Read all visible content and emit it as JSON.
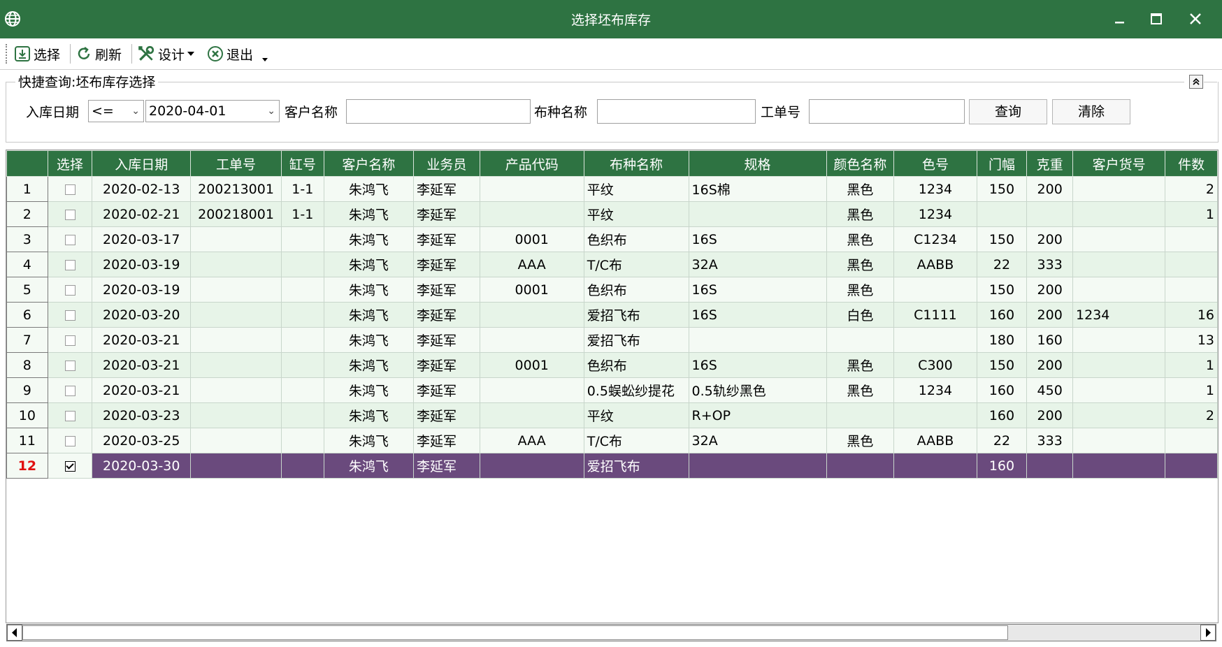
{
  "window": {
    "title": "选择坯布库存"
  },
  "toolbar": {
    "select": "选择",
    "refresh": "刷新",
    "design": "设计",
    "exit": "退出"
  },
  "query": {
    "legend": "快捷查询:坯布库存选择",
    "date_label": "入库日期",
    "operator": "<=",
    "date_value": "2020-04-01",
    "customer_label": "客户名称",
    "fabric_label": "布种名称",
    "order_label": "工单号",
    "search_btn": "查询",
    "clear_btn": "清除"
  },
  "table": {
    "columns": [
      "",
      "选择",
      "入库日期",
      "工单号",
      "缸号",
      "客户名称",
      "业务员",
      "产品代码",
      "布种名称",
      "规格",
      "颜色名称",
      "色号",
      "门幅",
      "克重",
      "客户货号",
      "件数"
    ],
    "rows": [
      {
        "no": "1",
        "checked": false,
        "date": "2020-02-13",
        "order": "200213001",
        "vat": "1-1",
        "customer": "朱鸿飞",
        "sales": "李延军",
        "code": "",
        "fabric": "平纹",
        "spec": "16S棉",
        "color": "黑色",
        "colorno": "1234",
        "width": "150",
        "weight": "200",
        "custno": "",
        "pieces": "2"
      },
      {
        "no": "2",
        "checked": false,
        "date": "2020-02-21",
        "order": "200218001",
        "vat": "1-1",
        "customer": "朱鸿飞",
        "sales": "李延军",
        "code": "",
        "fabric": "平纹",
        "spec": "",
        "color": "黑色",
        "colorno": "1234",
        "width": "",
        "weight": "",
        "custno": "",
        "pieces": "1"
      },
      {
        "no": "3",
        "checked": false,
        "date": "2020-03-17",
        "order": "",
        "vat": "",
        "customer": "朱鸿飞",
        "sales": "李延军",
        "code": "0001",
        "fabric": "色织布",
        "spec": "16S",
        "color": "黑色",
        "colorno": "C1234",
        "width": "150",
        "weight": "200",
        "custno": "",
        "pieces": ""
      },
      {
        "no": "4",
        "checked": false,
        "date": "2020-03-19",
        "order": "",
        "vat": "",
        "customer": "朱鸿飞",
        "sales": "李延军",
        "code": "AAA",
        "fabric": "T/C布",
        "spec": "32A",
        "color": "黑色",
        "colorno": "AABB",
        "width": "22",
        "weight": "333",
        "custno": "",
        "pieces": ""
      },
      {
        "no": "5",
        "checked": false,
        "date": "2020-03-19",
        "order": "",
        "vat": "",
        "customer": "朱鸿飞",
        "sales": "李延军",
        "code": "0001",
        "fabric": "色织布",
        "spec": "16S",
        "color": "黑色",
        "colorno": "",
        "width": "150",
        "weight": "200",
        "custno": "",
        "pieces": ""
      },
      {
        "no": "6",
        "checked": false,
        "date": "2020-03-20",
        "order": "",
        "vat": "",
        "customer": "朱鸿飞",
        "sales": "李延军",
        "code": "",
        "fabric": "爱招飞布",
        "spec": "16S",
        "color": "白色",
        "colorno": "C1111",
        "width": "160",
        "weight": "200",
        "custno": "1234",
        "pieces": "16"
      },
      {
        "no": "7",
        "checked": false,
        "date": "2020-03-21",
        "order": "",
        "vat": "",
        "customer": "朱鸿飞",
        "sales": "李延军",
        "code": "",
        "fabric": "爱招飞布",
        "spec": "",
        "color": "",
        "colorno": "",
        "width": "180",
        "weight": "160",
        "custno": "",
        "pieces": "13"
      },
      {
        "no": "8",
        "checked": false,
        "date": "2020-03-21",
        "order": "",
        "vat": "",
        "customer": "朱鸿飞",
        "sales": "李延军",
        "code": "0001",
        "fabric": "色织布",
        "spec": "16S",
        "color": "黑色",
        "colorno": "C300",
        "width": "150",
        "weight": "200",
        "custno": "",
        "pieces": "1"
      },
      {
        "no": "9",
        "checked": false,
        "date": "2020-03-21",
        "order": "",
        "vat": "",
        "customer": "朱鸿飞",
        "sales": "李延军",
        "code": "",
        "fabric": "0.5蜈蚣纱提花",
        "spec": "0.5轨纱黑色",
        "color": "黑色",
        "colorno": "1234",
        "width": "160",
        "weight": "450",
        "custno": "",
        "pieces": "1"
      },
      {
        "no": "10",
        "checked": false,
        "date": "2020-03-23",
        "order": "",
        "vat": "",
        "customer": "朱鸿飞",
        "sales": "李延军",
        "code": "",
        "fabric": "平纹",
        "spec": "R+OP",
        "color": "",
        "colorno": "",
        "width": "160",
        "weight": "200",
        "custno": "",
        "pieces": "2"
      },
      {
        "no": "11",
        "checked": false,
        "date": "2020-03-25",
        "order": "",
        "vat": "",
        "customer": "朱鸿飞",
        "sales": "李延军",
        "code": "AAA",
        "fabric": "T/C布",
        "spec": "32A",
        "color": "黑色",
        "colorno": "AABB",
        "width": "22",
        "weight": "333",
        "custno": "",
        "pieces": ""
      },
      {
        "no": "12",
        "checked": true,
        "date": "2020-03-30",
        "order": "",
        "vat": "",
        "customer": "朱鸿飞",
        "sales": "李延军",
        "code": "",
        "fabric": "爱招飞布",
        "spec": "",
        "color": "",
        "colorno": "",
        "width": "160",
        "weight": "",
        "custno": "",
        "pieces": ""
      }
    ],
    "selected_row": "12"
  }
}
